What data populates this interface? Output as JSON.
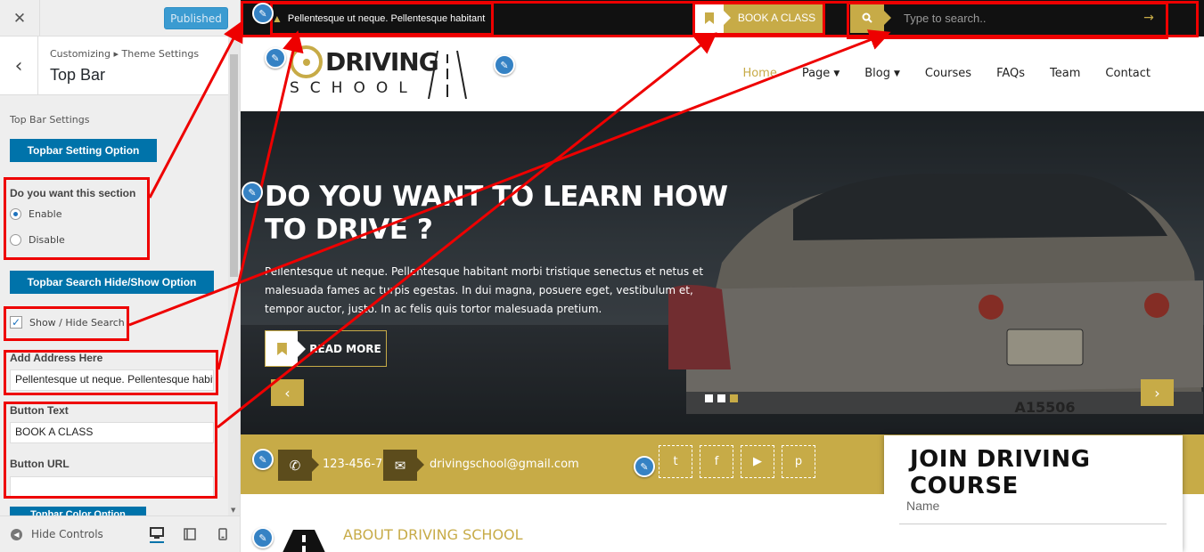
{
  "customizer": {
    "published_label": "Published",
    "breadcrumb": "Customizing ▸ Theme Settings",
    "section_title": "Top Bar",
    "settings_label": "Top Bar Settings",
    "topbar_setting_option": "Topbar Setting Option",
    "section_question": "Do you want this section",
    "radio_enable": "Enable",
    "radio_disable": "Disable",
    "search_option_btn": "Topbar Search Hide/Show Option",
    "show_hide_search": "Show / Hide Search",
    "address_label": "Add Address Here",
    "address_value": "Pellentesque ut neque. Pellentesque habitant",
    "button_text_label": "Button Text",
    "button_text_value": "BOOK A CLASS",
    "button_url_label": "Button URL",
    "button_url_value": "",
    "color_option_btn": "Topbar Color Option",
    "hide_controls": "Hide Controls"
  },
  "site": {
    "topbar": {
      "address": "Pellentesque ut neque. Pellentesque habitant",
      "book_label": "BOOK A CLASS",
      "search_placeholder": "Type to search.."
    },
    "logo": {
      "line1": "DRIVING",
      "line2": "SCHOOL"
    },
    "nav": [
      {
        "label": "Home"
      },
      {
        "label": "Page"
      },
      {
        "label": "Blog"
      },
      {
        "label": "Courses"
      },
      {
        "label": "FAQs"
      },
      {
        "label": "Team"
      },
      {
        "label": "Contact"
      }
    ],
    "hero": {
      "title": "DO YOU WANT TO LEARN HOW TO DRIVE ?",
      "description": "Pellentesque ut neque. Pellentesque habitant morbi tristique senectus et netus et malesuada fames ac turpis egestas. In dui magna, posuere eget, vestibulum et, tempor auctor, justo. In ac felis quis tortor malesuada pretium.",
      "button_label": "READ MORE",
      "prev_arrow": "‹",
      "next_arrow": "›",
      "plate": "A15506"
    },
    "contact": {
      "phone": "123-456-7",
      "email": "drivingschool@gmail.com"
    },
    "join": {
      "title": "JOIN DRIVING COURSE",
      "name_placeholder": "Name"
    },
    "about": {
      "title": "ABOUT DRIVING SCHOOL"
    }
  },
  "colors": {
    "accent": "#c7ab47",
    "wp_blue": "#0073aa",
    "annotation_red": "#ee0000"
  }
}
